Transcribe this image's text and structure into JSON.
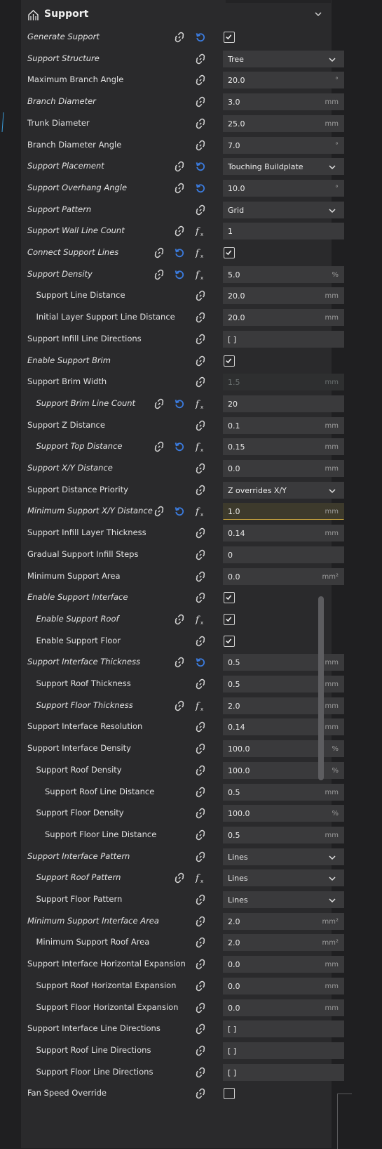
{
  "section": {
    "title": "Support",
    "icon": "support-category-icon",
    "collapse_icon": "chevron-down-icon"
  },
  "colors": {
    "panel": "#2a2a2c",
    "control": "#3a3a3c",
    "link_icon": "#d8d8d8",
    "reset_icon": "#3b7ce0",
    "warning_underline": "#d8b040",
    "text": "#e3e3e3"
  },
  "settings": [
    {
      "label": "Generate Support",
      "italic": true,
      "indent": 0,
      "link": true,
      "reset": true,
      "fx": false,
      "type": "checkbox",
      "checked": true
    },
    {
      "label": "Support Structure",
      "italic": true,
      "indent": 0,
      "link": true,
      "reset": false,
      "fx": false,
      "type": "select",
      "value": "Tree"
    },
    {
      "label": "Maximum Branch Angle",
      "italic": false,
      "indent": 0,
      "link": true,
      "reset": false,
      "fx": false,
      "type": "number",
      "value": "20.0",
      "unit": "°"
    },
    {
      "label": "Branch Diameter",
      "italic": true,
      "indent": 0,
      "link": true,
      "reset": false,
      "fx": false,
      "type": "number",
      "value": "3.0",
      "unit": "mm"
    },
    {
      "label": "Trunk Diameter",
      "italic": false,
      "indent": 0,
      "link": true,
      "reset": false,
      "fx": false,
      "type": "number",
      "value": "25.0",
      "unit": "mm"
    },
    {
      "label": "Branch Diameter Angle",
      "italic": false,
      "indent": 0,
      "link": true,
      "reset": false,
      "fx": false,
      "type": "number",
      "value": "7.0",
      "unit": "°"
    },
    {
      "label": "Support Placement",
      "italic": true,
      "indent": 0,
      "link": true,
      "reset": true,
      "fx": false,
      "type": "select",
      "value": "Touching Buildplate"
    },
    {
      "label": "Support Overhang Angle",
      "italic": true,
      "indent": 0,
      "link": true,
      "reset": true,
      "fx": false,
      "type": "number",
      "value": "10.0",
      "unit": "°"
    },
    {
      "label": "Support Pattern",
      "italic": true,
      "indent": 0,
      "link": true,
      "reset": false,
      "fx": false,
      "type": "select",
      "value": "Grid"
    },
    {
      "label": "Support Wall Line Count",
      "italic": true,
      "indent": 0,
      "link": true,
      "reset": false,
      "fx": true,
      "type": "number",
      "value": "1",
      "unit": ""
    },
    {
      "label": "Connect Support Lines",
      "italic": true,
      "indent": 0,
      "link": true,
      "reset": true,
      "fx": true,
      "type": "checkbox",
      "checked": true
    },
    {
      "label": "Support Density",
      "italic": true,
      "indent": 0,
      "link": true,
      "reset": true,
      "fx": true,
      "type": "number",
      "value": "5.0",
      "unit": "%"
    },
    {
      "label": "Support Line Distance",
      "italic": false,
      "indent": 1,
      "link": true,
      "reset": false,
      "fx": false,
      "type": "number",
      "value": "20.0",
      "unit": "mm"
    },
    {
      "label": "Initial Layer Support Line Distance",
      "italic": false,
      "indent": 1,
      "link": true,
      "reset": false,
      "fx": false,
      "type": "number",
      "value": "20.0",
      "unit": "mm"
    },
    {
      "label": "Support Infill Line Directions",
      "italic": false,
      "indent": 0,
      "link": true,
      "reset": false,
      "fx": false,
      "type": "text",
      "value": "[ ]",
      "unit": ""
    },
    {
      "label": "Enable Support Brim",
      "italic": true,
      "indent": 0,
      "link": true,
      "reset": false,
      "fx": false,
      "type": "checkbox",
      "checked": true
    },
    {
      "label": "Support Brim Width",
      "italic": false,
      "indent": 0,
      "link": true,
      "reset": false,
      "fx": false,
      "type": "number",
      "value": "1.5",
      "unit": "mm",
      "disabled": true
    },
    {
      "label": "Support Brim Line Count",
      "italic": true,
      "indent": 1,
      "link": true,
      "reset": true,
      "fx": true,
      "type": "number",
      "value": "20",
      "unit": ""
    },
    {
      "label": "Support Z Distance",
      "italic": false,
      "indent": 0,
      "link": true,
      "reset": false,
      "fx": false,
      "type": "number",
      "value": "0.1",
      "unit": "mm"
    },
    {
      "label": "Support Top Distance",
      "italic": true,
      "indent": 1,
      "link": true,
      "reset": true,
      "fx": true,
      "type": "number",
      "value": "0.15",
      "unit": "mm"
    },
    {
      "label": "Support X/Y Distance",
      "italic": true,
      "indent": 0,
      "link": true,
      "reset": false,
      "fx": false,
      "type": "number",
      "value": "0.0",
      "unit": "mm"
    },
    {
      "label": "Support Distance Priority",
      "italic": false,
      "indent": 0,
      "link": true,
      "reset": false,
      "fx": false,
      "type": "select",
      "value": "Z overrides X/Y"
    },
    {
      "label": "Minimum Support X/Y Distance",
      "italic": true,
      "indent": 0,
      "link": true,
      "reset": true,
      "fx": true,
      "type": "number",
      "value": "1.0",
      "unit": "mm",
      "warning": true
    },
    {
      "label": "Support Infill Layer Thickness",
      "italic": false,
      "indent": 0,
      "link": true,
      "reset": false,
      "fx": false,
      "type": "number",
      "value": "0.14",
      "unit": "mm"
    },
    {
      "label": "Gradual Support Infill Steps",
      "italic": false,
      "indent": 0,
      "link": true,
      "reset": false,
      "fx": false,
      "type": "number",
      "value": "0",
      "unit": ""
    },
    {
      "label": "Minimum Support Area",
      "italic": false,
      "indent": 0,
      "link": true,
      "reset": false,
      "fx": false,
      "type": "number",
      "value": "0.0",
      "unit": "mm²"
    },
    {
      "label": "Enable Support Interface",
      "italic": true,
      "indent": 0,
      "link": true,
      "reset": false,
      "fx": false,
      "type": "checkbox",
      "checked": true
    },
    {
      "label": "Enable Support Roof",
      "italic": true,
      "indent": 1,
      "link": true,
      "reset": false,
      "fx": true,
      "type": "checkbox",
      "checked": true
    },
    {
      "label": "Enable Support Floor",
      "italic": false,
      "indent": 1,
      "link": true,
      "reset": false,
      "fx": false,
      "type": "checkbox",
      "checked": true
    },
    {
      "label": "Support Interface Thickness",
      "italic": true,
      "indent": 0,
      "link": true,
      "reset": true,
      "fx": false,
      "type": "number",
      "value": "0.5",
      "unit": "mm"
    },
    {
      "label": "Support Roof Thickness",
      "italic": false,
      "indent": 1,
      "link": true,
      "reset": false,
      "fx": false,
      "type": "number",
      "value": "0.5",
      "unit": "mm"
    },
    {
      "label": "Support Floor Thickness",
      "italic": true,
      "indent": 1,
      "link": true,
      "reset": false,
      "fx": true,
      "type": "number",
      "value": "2.0",
      "unit": "mm"
    },
    {
      "label": "Support Interface Resolution",
      "italic": false,
      "indent": 0,
      "link": true,
      "reset": false,
      "fx": false,
      "type": "number",
      "value": "0.14",
      "unit": "mm"
    },
    {
      "label": "Support Interface Density",
      "italic": false,
      "indent": 0,
      "link": true,
      "reset": false,
      "fx": false,
      "type": "number",
      "value": "100.0",
      "unit": "%"
    },
    {
      "label": "Support Roof Density",
      "italic": false,
      "indent": 1,
      "link": true,
      "reset": false,
      "fx": false,
      "type": "number",
      "value": "100.0",
      "unit": "%"
    },
    {
      "label": "Support Roof Line Distance",
      "italic": false,
      "indent": 2,
      "link": true,
      "reset": false,
      "fx": false,
      "type": "number",
      "value": "0.5",
      "unit": "mm"
    },
    {
      "label": "Support Floor Density",
      "italic": false,
      "indent": 1,
      "link": true,
      "reset": false,
      "fx": false,
      "type": "number",
      "value": "100.0",
      "unit": "%"
    },
    {
      "label": "Support Floor Line Distance",
      "italic": false,
      "indent": 2,
      "link": true,
      "reset": false,
      "fx": false,
      "type": "number",
      "value": "0.5",
      "unit": "mm"
    },
    {
      "label": "Support Interface Pattern",
      "italic": true,
      "indent": 0,
      "link": true,
      "reset": false,
      "fx": false,
      "type": "select",
      "value": "Lines"
    },
    {
      "label": "Support Roof Pattern",
      "italic": true,
      "indent": 1,
      "link": true,
      "reset": false,
      "fx": true,
      "type": "select",
      "value": "Lines"
    },
    {
      "label": "Support Floor Pattern",
      "italic": false,
      "indent": 1,
      "link": true,
      "reset": false,
      "fx": false,
      "type": "select",
      "value": "Lines"
    },
    {
      "label": "Minimum Support Interface Area",
      "italic": true,
      "indent": 0,
      "link": true,
      "reset": false,
      "fx": false,
      "type": "number",
      "value": "2.0",
      "unit": "mm²"
    },
    {
      "label": "Minimum Support Roof Area",
      "italic": false,
      "indent": 1,
      "link": true,
      "reset": false,
      "fx": false,
      "type": "number",
      "value": "2.0",
      "unit": "mm²"
    },
    {
      "label": "Support Interface Horizontal Expansion",
      "italic": false,
      "indent": 0,
      "link": true,
      "reset": false,
      "fx": false,
      "type": "number",
      "value": "0.0",
      "unit": "mm"
    },
    {
      "label": "Support Roof Horizontal Expansion",
      "italic": false,
      "indent": 1,
      "link": true,
      "reset": false,
      "fx": false,
      "type": "number",
      "value": "0.0",
      "unit": "mm"
    },
    {
      "label": "Support Floor Horizontal Expansion",
      "italic": false,
      "indent": 1,
      "link": true,
      "reset": false,
      "fx": false,
      "type": "number",
      "value": "0.0",
      "unit": "mm"
    },
    {
      "label": "Support Interface Line Directions",
      "italic": false,
      "indent": 0,
      "link": true,
      "reset": false,
      "fx": false,
      "type": "text",
      "value": "[ ]",
      "unit": ""
    },
    {
      "label": "Support Roof Line Directions",
      "italic": false,
      "indent": 1,
      "link": true,
      "reset": false,
      "fx": false,
      "type": "text",
      "value": "[ ]",
      "unit": ""
    },
    {
      "label": "Support Floor Line Directions",
      "italic": false,
      "indent": 1,
      "link": true,
      "reset": false,
      "fx": false,
      "type": "text",
      "value": "[ ]",
      "unit": ""
    },
    {
      "label": "Fan Speed Override",
      "italic": false,
      "indent": 0,
      "link": true,
      "reset": false,
      "fx": false,
      "type": "checkbox",
      "checked": false
    }
  ]
}
